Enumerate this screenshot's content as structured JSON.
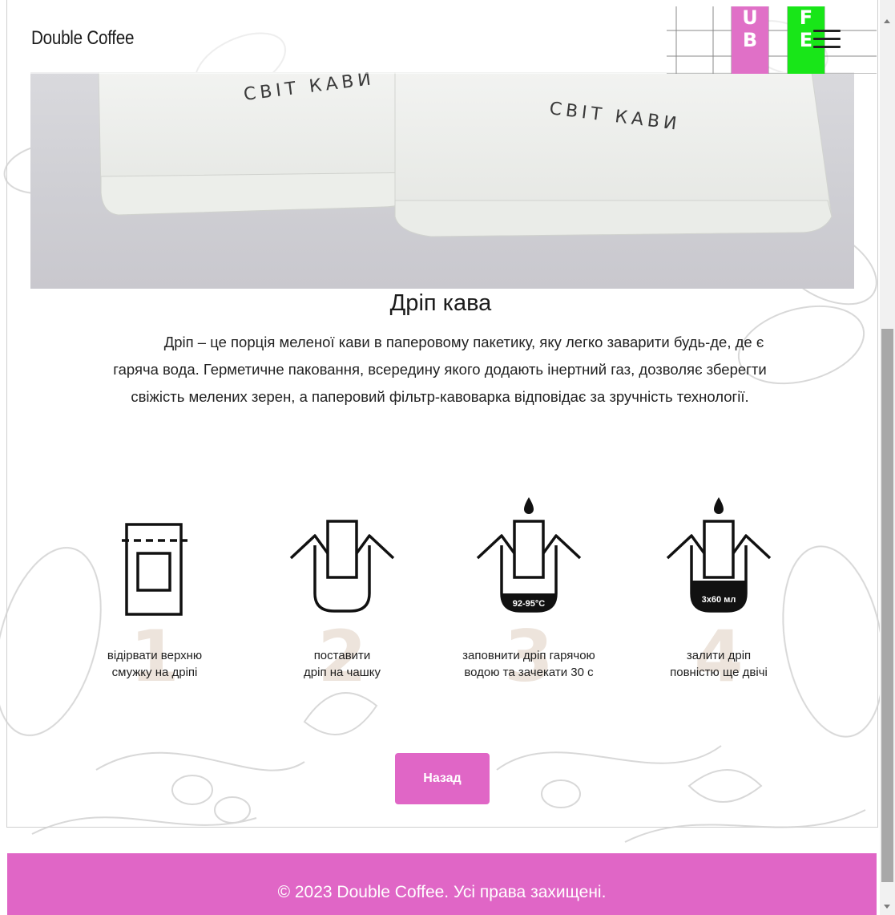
{
  "header": {
    "brand": "Double Coffee",
    "logo_tiles": [
      {
        "letters": [
          "U",
          "B"
        ],
        "color": "#e070c7"
      },
      {
        "letters": [
          "F",
          "E"
        ],
        "color": "#18e618"
      }
    ],
    "menu_icon": "hamburger-icon"
  },
  "hero": {
    "pack_text_left": "СВІТ КАВИ",
    "pack_text_right": "СВІТ КАВИ"
  },
  "article": {
    "title": "Дріп кава",
    "description_lines": [
      "Дріп – це порція меленої кави в паперовому пакетику, яку легко заварити будь-де, де є",
      "гаряча вода. Герметичне паковання, всередину якого додають інертний газ, дозволяє зберегти",
      "свіжість мелених зерен, а паперовий фільтр-кавоварка відповідає за зручність технології."
    ]
  },
  "steps": [
    {
      "number": "1",
      "icon": "open-drip-bag-icon",
      "label_lines": [
        "відірвати верхню",
        "смужку на дріпі"
      ]
    },
    {
      "number": "2",
      "icon": "drip-on-cup-icon",
      "label_lines": [
        "поставити",
        "дріп на чашку"
      ]
    },
    {
      "number": "3",
      "icon": "drip-pour-water-icon",
      "badge": "92-95°C",
      "label_lines": [
        "заповнити дріп гарячою",
        "водою та зачекати 30 с"
      ]
    },
    {
      "number": "4",
      "icon": "drip-refill-icon",
      "badge": "3х60 мл",
      "label_lines": [
        "залити дріп",
        "повністю ще двічі"
      ]
    }
  ],
  "back_button": "Назад",
  "footer": {
    "text": "© 2023 Double Coffee. Усі права захищені."
  },
  "colors": {
    "accent": "#e066c6",
    "tile_pink": "#e070c7",
    "tile_green": "#18e618",
    "step_number": "#ede4dc"
  }
}
